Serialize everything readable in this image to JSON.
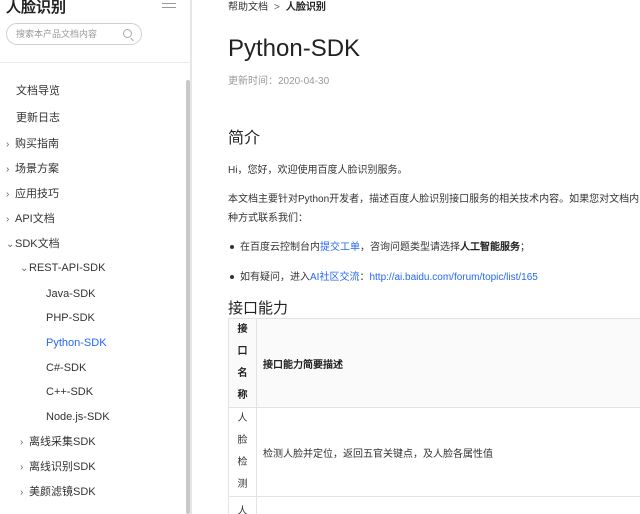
{
  "sidebar": {
    "title": "人脸识别",
    "search_placeholder": "搜索本产品文档内容",
    "items": [
      {
        "label": "文档导览",
        "chevron": "",
        "level": 0,
        "active": false
      },
      {
        "label": "更新日志",
        "chevron": "",
        "level": 0,
        "active": false
      },
      {
        "label": "购买指南",
        "chevron": "›",
        "level": 0,
        "active": false
      },
      {
        "label": "场景方案",
        "chevron": "›",
        "level": 0,
        "active": false
      },
      {
        "label": "应用技巧",
        "chevron": "›",
        "level": 0,
        "active": false
      },
      {
        "label": "API文档",
        "chevron": "›",
        "level": 0,
        "active": false
      },
      {
        "label": "SDK文档",
        "chevron": "⌄",
        "level": 0,
        "active": false
      },
      {
        "label": "REST-API-SDK",
        "chevron": "⌄",
        "level": 1,
        "active": false
      },
      {
        "label": "Java-SDK",
        "chevron": "",
        "level": 2,
        "active": false
      },
      {
        "label": "PHP-SDK",
        "chevron": "",
        "level": 2,
        "active": false
      },
      {
        "label": "Python-SDK",
        "chevron": "",
        "level": 2,
        "active": true
      },
      {
        "label": "C#-SDK",
        "chevron": "",
        "level": 2,
        "active": false
      },
      {
        "label": "C++-SDK",
        "chevron": "",
        "level": 2,
        "active": false
      },
      {
        "label": "Node.js-SDK",
        "chevron": "",
        "level": 2,
        "active": false
      },
      {
        "label": "离线采集SDK",
        "chevron": "›",
        "level": 1,
        "active": false
      },
      {
        "label": "离线识别SDK",
        "chevron": "›",
        "level": 1,
        "active": false
      },
      {
        "label": "美颜滤镜SDK",
        "chevron": "›",
        "level": 1,
        "active": false
      }
    ]
  },
  "breadcrumb": {
    "parent": "帮助文档",
    "separator": ">",
    "current": "人脸识别"
  },
  "page": {
    "title": "Python-SDK",
    "updated": "更新时间：2020-04-30"
  },
  "intro": {
    "heading": "简介",
    "greeting": "Hi，您好，欢迎使用百度人脸识别服务。",
    "desc_line1": "本文档主要针对Python开发者，描述百度人脸识别接口服务的相关技术内容。如果您对文档内",
    "desc_line2": "种方式联系我们：",
    "bullet1_prefix": "在百度云控制台内",
    "bullet1_link": "提交工单",
    "bullet1_mid": "，咨询问题类型请选择",
    "bullet1_strong": "人工智能服务",
    "bullet1_suffix": "；",
    "bullet2_prefix": "如有疑问，进入",
    "bullet2_link": "AI社区交流",
    "bullet2_mid": "：",
    "bullet2_url": "http://ai.baidu.com/forum/topic/list/165"
  },
  "capabilities": {
    "heading": "接口能力",
    "col_name": "接口名称",
    "col_desc": "接口能力简要描述",
    "rows": [
      {
        "name": "人脸检测",
        "desc": "检测人脸并定位，返回五官关键点，及人脸各属性值"
      },
      {
        "name": "人",
        "desc": ""
      }
    ]
  },
  "colors": {
    "accent": "#2468f2"
  }
}
